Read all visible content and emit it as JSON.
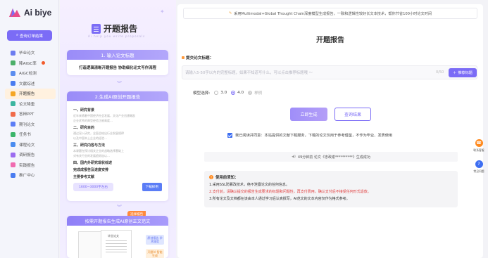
{
  "app": {
    "logo_text": "Ai biye",
    "query_orders": "查询订单结果"
  },
  "sidebar": {
    "items": [
      {
        "label": "毕业论文",
        "icon": "graduation-icon",
        "color": "#6c7cf0"
      },
      {
        "label": "降AIGC率",
        "icon": "aigc-down-icon",
        "color": "#4caf6a",
        "hot": true
      },
      {
        "label": "AIGC检测",
        "icon": "aigc-detect-icon",
        "color": "#5b8def"
      },
      {
        "label": "文献综述",
        "icon": "literature-icon",
        "color": "#4a7cf0"
      },
      {
        "label": "开题报告",
        "icon": "proposal-icon",
        "color": "#f5a623",
        "active": true
      },
      {
        "label": "论文降重",
        "icon": "dedupe-icon",
        "color": "#3bb5a0"
      },
      {
        "label": "答辩PPT",
        "icon": "ppt-icon",
        "color": "#f06b4a"
      },
      {
        "label": "期刊论文",
        "icon": "journal-icon",
        "color": "#5b7df6"
      },
      {
        "label": "任务书",
        "icon": "task-book-icon",
        "color": "#3bb56a"
      },
      {
        "label": "课程论文",
        "icon": "course-paper-icon",
        "color": "#4a8cf0"
      },
      {
        "label": "调研报告",
        "icon": "survey-icon",
        "color": "#9b6cf0"
      },
      {
        "label": "实践报告",
        "icon": "practice-icon",
        "color": "#f06bb0"
      },
      {
        "label": "推广中心",
        "icon": "promotion-icon",
        "color": "#4a7cf0"
      }
    ]
  },
  "promo": {
    "title": "开题报告",
    "subtitle": "Ai help you write proposals",
    "step1_title": "1. 输入论文标题",
    "step1_body": "打造逻辑清晰开题报告 协助细化论文写作流程",
    "step2_title": "2.生成AI原创开题报告",
    "outline": [
      {
        "head": "一、研究背景",
        "lines": [
          "近年来随着中国经济社会发展，文化产业迅速崛起",
          "企业优秀的典型经验正被高度…"
        ]
      },
      {
        "head": "二、研究目的",
        "lines": [
          "通过深入研究，全面总结出行业发展规律",
          "以及中国本土企业的经验…"
        ]
      },
      {
        "head": "三、研究内容与方法",
        "lines": [
          "本课题在探讨相关企业的战略选择基础上",
          "对有关行业的发展趋势加以…"
        ]
      },
      {
        "head": "四、国内外研究现状综述",
        "lines": []
      },
      {
        "head": "完成成报告及进度安排",
        "lines": []
      },
      {
        "head": "主要参考文献",
        "lines": []
      }
    ],
    "word_count": "1600~3000字左右",
    "download_label": "下载样例",
    "step3_badge": "选择报告",
    "step3_title": "按需开题报告生成AI原创正文范文",
    "paper_label": "毕业论文",
    "tag_a": "原创报告 学术规范",
    "tag_b": "开题AI 智能生成"
  },
  "main": {
    "banner": "采用Multimodal+Global Thought Chain深度模型生成报告，一致和逻辑性较好长文本技术，帮你节省100小时论文时间",
    "title": "开题报告",
    "field_label": "提交论文标题：",
    "input_placeholder": "请输入5-50字以内的完整标题，如果不知道写什么，可以点击推荐标题哦 ～",
    "input_value": "",
    "counter": "0/50",
    "recommend_label": "推荐标题",
    "model_label": "模型选择:",
    "model_options": [
      "3.0",
      "4.0"
    ],
    "model_selected": "4.0",
    "model_hint": "样例",
    "generate_label": "立即生成",
    "result_label": "查询结果",
    "agree_text": "我已阅读并同意：本站提供的文献下载服务，下载的论文仅用于参考借鉴，不作为毕业、发表使用",
    "ticker": "49分钟前  论文《忠政谢**********》生成成功",
    "notice_title": "使用前须知：",
    "notice_lines": [
      "1.采用SSL防篡改技术，绝不泄露论文的任何信息。",
      "2.支付前，请确认提交的报告生成要求的标题和问题性，再支付费用，确认支付后不接受任何形式退款。",
      "3.所有论文及文档都在该由本人通过学习后认真撰写，AI范文的文本内容仅作为格式参考。"
    ]
  },
  "floating": {
    "service": "联系客服",
    "help": "常见问题"
  }
}
